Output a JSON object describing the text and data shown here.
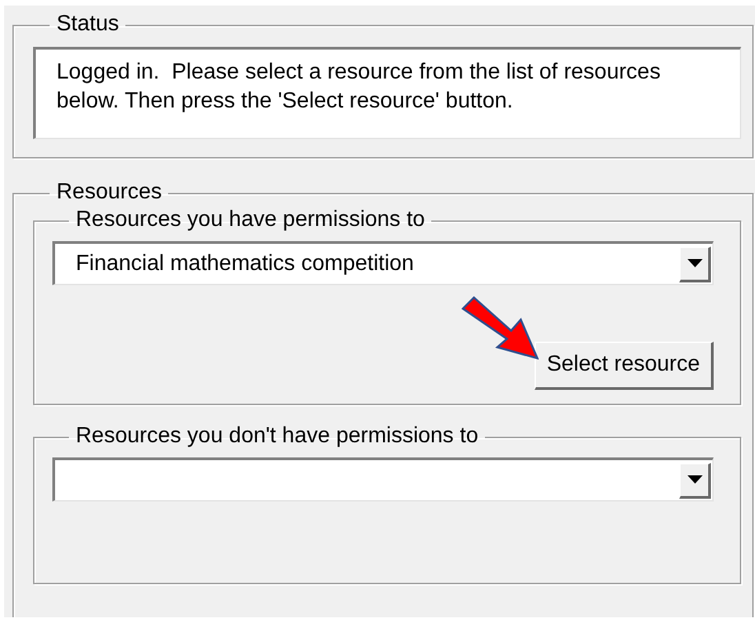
{
  "status": {
    "legend": "Status",
    "message": "Logged in.  Please select a resource from the list of resources below. Then press the 'Select resource' button."
  },
  "resources": {
    "legend": "Resources",
    "groups": [
      {
        "legend": "Resources you have permissions to",
        "dropdown": {
          "value": "Financial mathematics competition"
        },
        "button": {
          "label": "Select resource"
        }
      },
      {
        "legend": "Resources you don't have permissions to"
      }
    ]
  }
}
